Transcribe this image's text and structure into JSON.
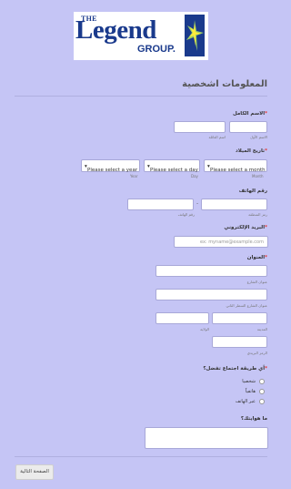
{
  "logo": {
    "line1": "THE",
    "line2": "Legend",
    "line3": "GROUP."
  },
  "section_title": "المعلومات اشخصية",
  "full_name": {
    "label": "الاسم الكامل",
    "required_mark": "*",
    "first_sub": "الاسم الأول",
    "last_sub": "اسم العائلة"
  },
  "birth_date": {
    "label": "تاريخ الميلاد",
    "required_mark": "*",
    "month": {
      "value": "Please select a month",
      "sub": "Month"
    },
    "day": {
      "value": "Please select a day",
      "sub": "Day"
    },
    "year": {
      "value": "Please select a year",
      "sub": "Year"
    }
  },
  "phone": {
    "label": "رقم الهاتف",
    "dash": "-",
    "area_sub": "رمز المنطقة",
    "number_sub": "رقم الهاتف"
  },
  "email": {
    "label": "البريد الإلكتروني",
    "required_mark": "*",
    "placeholder": "ex: myname@example.com"
  },
  "address": {
    "label": "العنوان",
    "required_mark": "*",
    "street1_sub": "عنوان الشارع",
    "street2_sub": "عنوان الشارع السطر الثاني",
    "city_sub": "المدينة",
    "state_sub": "الولاية",
    "zip_sub": "الرمز البريدي"
  },
  "contact_method": {
    "label": "أي طريقة اجتماع تفضل؟",
    "required_mark": "*",
    "options": [
      "شخصيا",
      "هاتفياً",
      "عبر الهاتف"
    ]
  },
  "hobbies": {
    "label": "ما هوايتك؟"
  },
  "next_button": "الصفحة التالية"
}
